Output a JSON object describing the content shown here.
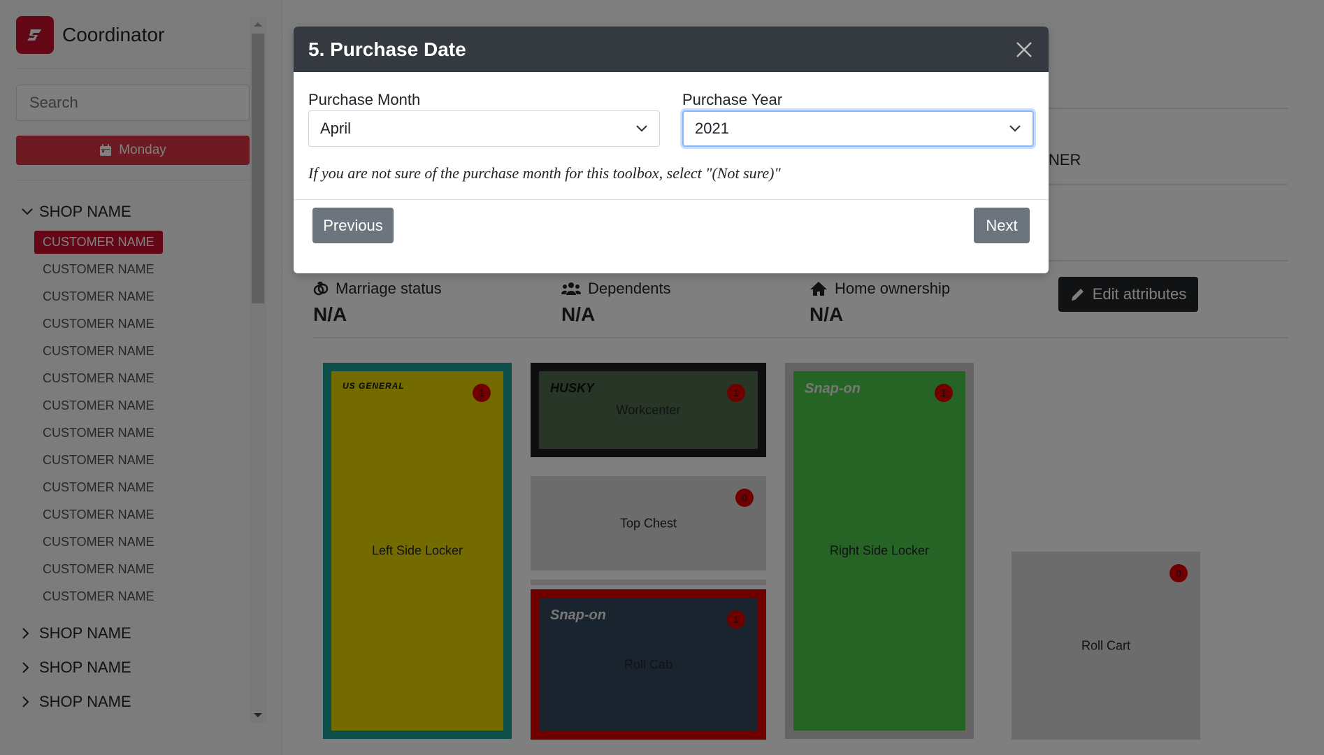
{
  "sidebar": {
    "app_title": "Coordinator",
    "search_placeholder": "Search",
    "day_button": "Monday",
    "shops": [
      {
        "name": "SHOP NAME",
        "expanded": true,
        "customers": [
          "CUSTOMER NAME",
          "CUSTOMER NAME",
          "CUSTOMER NAME",
          "CUSTOMER NAME",
          "CUSTOMER NAME",
          "CUSTOMER NAME",
          "CUSTOMER NAME",
          "CUSTOMER NAME",
          "CUSTOMER NAME",
          "CUSTOMER NAME",
          "CUSTOMER NAME",
          "CUSTOMER NAME",
          "CUSTOMER NAME",
          "CUSTOMER NAME"
        ],
        "active_index": 0
      },
      {
        "name": "SHOP NAME",
        "expanded": false
      },
      {
        "name": "SHOP NAME",
        "expanded": false
      },
      {
        "name": "SHOP NAME",
        "expanded": false
      }
    ]
  },
  "main": {
    "partial_text": "NER",
    "attributes": [
      {
        "icon": "rings-icon",
        "label": "Marriage status",
        "value": "N/A"
      },
      {
        "icon": "users-icon",
        "label": "Dependents",
        "value": "N/A"
      },
      {
        "icon": "home-icon",
        "label": "Home ownership",
        "value": "N/A"
      }
    ],
    "edit_button": "Edit attributes",
    "toolboxes": {
      "left_locker": {
        "label": "Left Side Locker",
        "brand": "US GENERAL",
        "badge": "1"
      },
      "workcenter": {
        "label": "Workcenter",
        "brand": "HUSKY",
        "badge": "1"
      },
      "top_chest": {
        "label": "Top Chest",
        "badge": "0"
      },
      "roll_cab": {
        "label": "Roll Cab",
        "brand": "Snap-on",
        "badge": "1"
      },
      "right_locker": {
        "label": "Right Side Locker",
        "brand": "Snap-on",
        "badge": "1"
      },
      "roll_cart": {
        "label": "Roll Cart",
        "badge": "0"
      }
    }
  },
  "modal": {
    "title": "5. Purchase Date",
    "month_label": "Purchase Month",
    "month_value": "April",
    "year_label": "Purchase Year",
    "year_value": "2021",
    "hint": "If you are not sure of the purchase month for this toolbox, select \"(Not sure)\"",
    "previous_button": "Previous",
    "next_button": "Next"
  },
  "colors": {
    "brand_red": "#c8102e",
    "left_locker_frame": "#1a9e94",
    "left_locker_fill": "#e6d400",
    "right_locker_fill": "#4bc84b",
    "roll_cab_frame": "#e00000",
    "roll_cab_fill": "#34495e"
  }
}
